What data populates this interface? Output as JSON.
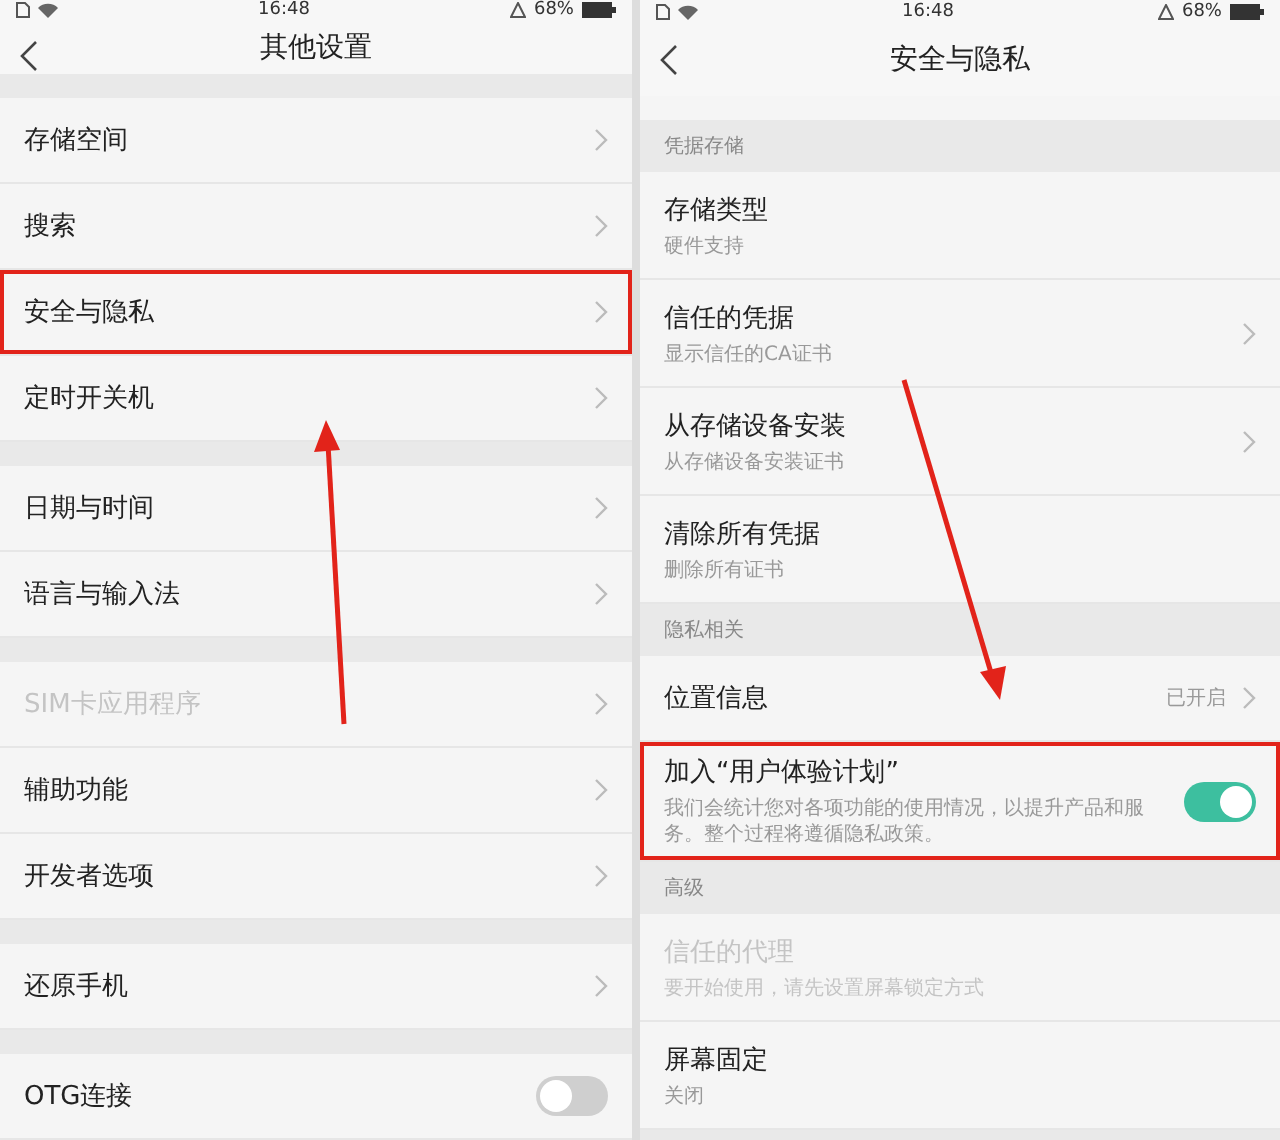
{
  "panels": [
    {
      "status_bar": {
        "time": "16:48",
        "battery": "68%"
      },
      "title": "其他设置",
      "sections": [
        {
          "items": [
            {
              "kind": "link",
              "label": "存储空间",
              "disabled": false,
              "highlighted": false
            },
            {
              "kind": "link",
              "label": "搜索",
              "disabled": false,
              "highlighted": false
            },
            {
              "kind": "link",
              "label": "安全与隐私",
              "disabled": false,
              "highlighted": true
            },
            {
              "kind": "link",
              "label": "定时开关机",
              "disabled": false,
              "highlighted": false
            }
          ]
        },
        {
          "items": [
            {
              "kind": "link",
              "label": "日期与时间",
              "disabled": false,
              "highlighted": false
            },
            {
              "kind": "link",
              "label": "语言与输入法",
              "disabled": false,
              "highlighted": false
            }
          ]
        },
        {
          "items": [
            {
              "kind": "link",
              "label": "SIM卡应用程序",
              "disabled": true,
              "highlighted": false
            },
            {
              "kind": "link",
              "label": "辅助功能",
              "disabled": false,
              "highlighted": false
            },
            {
              "kind": "link",
              "label": "开发者选项",
              "disabled": false,
              "highlighted": false
            }
          ]
        },
        {
          "items": [
            {
              "kind": "link",
              "label": "还原手机",
              "disabled": false,
              "highlighted": false
            }
          ]
        },
        {
          "items": [
            {
              "kind": "toggle",
              "label": "OTG连接",
              "on": false,
              "disabled": false,
              "highlighted": false
            }
          ]
        }
      ]
    },
    {
      "status_bar": {
        "time": "16:48",
        "battery": "68%"
      },
      "title": "安全与隐私",
      "top_strip": true,
      "sections": [
        {
          "header": "凭据存储",
          "items": [
            {
              "kind": "plain",
              "label": "存储类型",
              "subtitle": "硬件支持",
              "disabled": false,
              "highlighted": false
            },
            {
              "kind": "link",
              "label": "信任的凭据",
              "subtitle": "显示信任的CA证书",
              "disabled": false,
              "highlighted": false
            },
            {
              "kind": "link",
              "label": "从存储设备安装",
              "subtitle": "从存储设备安装证书",
              "disabled": false,
              "highlighted": false
            },
            {
              "kind": "plain",
              "label": "清除所有凭据",
              "subtitle": "删除所有证书",
              "disabled": false,
              "highlighted": false
            }
          ]
        },
        {
          "header": "隐私相关",
          "items": [
            {
              "kind": "link",
              "label": "位置信息",
              "value": "已开启",
              "disabled": false,
              "highlighted": false
            },
            {
              "kind": "toggle",
              "label": "加入“用户体验计划”",
              "subtitle": "我们会统计您对各项功能的使用情况，以提升产品和服务。整个过程将遵循隐私政策。",
              "on": true,
              "disabled": false,
              "highlighted": true
            }
          ]
        },
        {
          "header": "高级",
          "items": [
            {
              "kind": "plain",
              "label": "信任的代理",
              "subtitle": "要开始使用，请先设置屏幕锁定方式",
              "disabled": true,
              "highlighted": false
            },
            {
              "kind": "plain",
              "label": "屏幕固定",
              "subtitle": "关闭",
              "disabled": false,
              "highlighted": false
            }
          ]
        }
      ]
    }
  ]
}
